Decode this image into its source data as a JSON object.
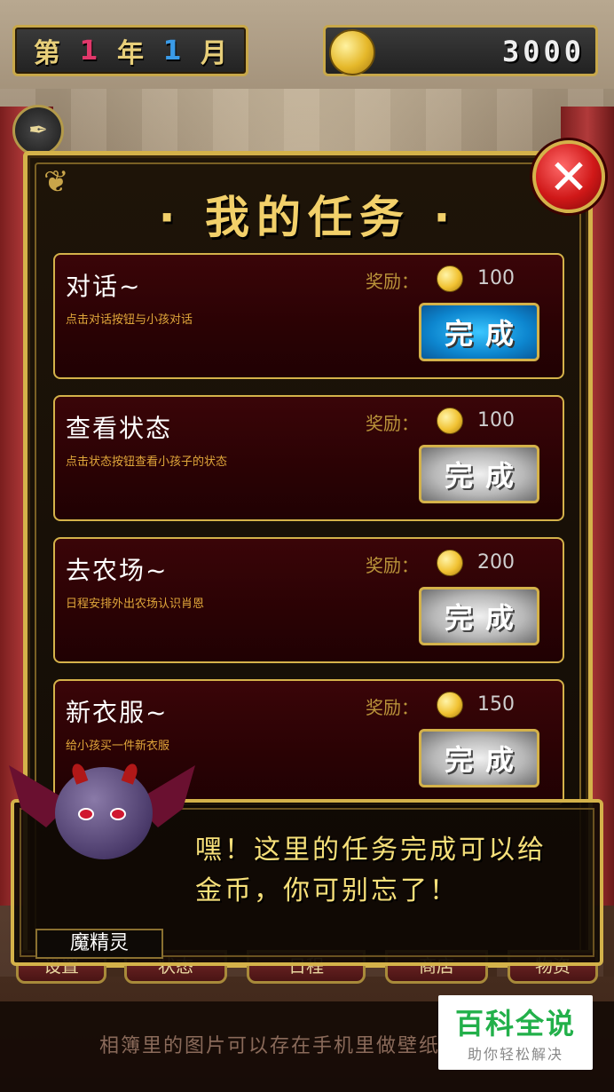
{
  "top_bar": {
    "date": {
      "prefix": "第",
      "year": "1",
      "year_unit": "年",
      "month": "1",
      "month_unit": "月"
    },
    "coins": "3000"
  },
  "panel": {
    "title": "· 我的任务 ·",
    "close_icon": "close-icon"
  },
  "tasks": [
    {
      "name": "对话~",
      "desc": "点击对话按钮与小孩对话",
      "reward_label": "奖励：",
      "reward": "100",
      "button": "完成",
      "button_state": "active"
    },
    {
      "name": "查看状态",
      "desc": "点击状态按钮查看小孩子的状态",
      "reward_label": "奖励：",
      "reward": "100",
      "button": "完成",
      "button_state": "disabled"
    },
    {
      "name": "去农场~",
      "desc": "日程安排外出农场认识肖恩",
      "reward_label": "奖励：",
      "reward": "200",
      "button": "完成",
      "button_state": "disabled"
    },
    {
      "name": "新衣服~",
      "desc": "给小孩买一件新衣服",
      "reward_label": "奖励：",
      "reward": "150",
      "button": "完成",
      "button_state": "disabled"
    }
  ],
  "dialog": {
    "line1": "嘿！这里的任务完成可以给",
    "line2": "金币，你可别忘了！",
    "speaker": "魔精灵"
  },
  "bottom_nav": [
    "设置",
    "状态",
    "日程",
    "商店",
    "物资"
  ],
  "tip": "相簿里的图片可以存在手机里做壁纸",
  "watermark": {
    "title": "百科全说",
    "subtitle": "助你轻松解决"
  },
  "colors": {
    "gold": "#d4b24a",
    "active_button": "#0d86cf",
    "title": "#f2d06a",
    "close": "#d01818"
  }
}
